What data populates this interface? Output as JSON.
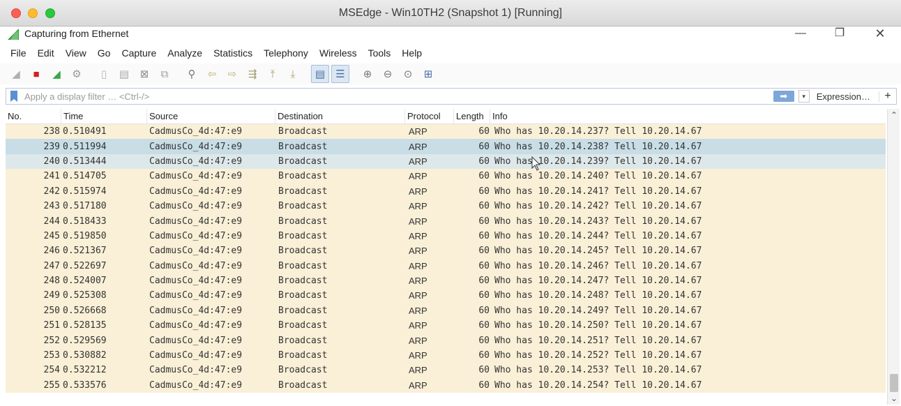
{
  "mac_window": {
    "title": "MSEdge - Win10TH2 (Snapshot 1) [Running]"
  },
  "app": {
    "title": "Capturing from Ethernet",
    "window_controls": {
      "minimize": "—",
      "restore": "❐",
      "close": "✕"
    }
  },
  "menu": [
    "File",
    "Edit",
    "View",
    "Go",
    "Capture",
    "Analyze",
    "Statistics",
    "Telephony",
    "Wireless",
    "Tools",
    "Help"
  ],
  "toolbar": {
    "icons": [
      {
        "name": "start-capture-icon",
        "glyph": "◢",
        "color": "#b0b0b0"
      },
      {
        "name": "stop-capture-icon",
        "glyph": "■",
        "color": "#d81e1e"
      },
      {
        "name": "restart-capture-icon",
        "glyph": "◢",
        "color": "#3aa64a"
      },
      {
        "name": "capture-options-icon",
        "glyph": "⚙",
        "color": "#9a9a9a"
      },
      {
        "name": "open-file-icon",
        "glyph": "▯",
        "color": "#b8b8b8"
      },
      {
        "name": "save-file-icon",
        "glyph": "▤",
        "color": "#a8a8a8"
      },
      {
        "name": "close-file-icon",
        "glyph": "⊠",
        "color": "#8c8c8c"
      },
      {
        "name": "reload-file-icon",
        "glyph": "⧉",
        "color": "#9a9a9a"
      },
      {
        "name": "find-packet-icon",
        "glyph": "⚲",
        "color": "#777777"
      },
      {
        "name": "go-back-icon",
        "glyph": "⇦",
        "color": "#c0b070"
      },
      {
        "name": "go-forward-icon",
        "glyph": "⇨",
        "color": "#c0b070"
      },
      {
        "name": "go-to-packet-icon",
        "glyph": "⇶",
        "color": "#a0a070"
      },
      {
        "name": "go-first-packet-icon",
        "glyph": "⤒",
        "color": "#b0a060"
      },
      {
        "name": "go-last-packet-icon",
        "glyph": "⤓",
        "color": "#b0a060"
      },
      {
        "name": "autoscroll-icon",
        "glyph": "▤",
        "color": "#4a6fa5",
        "pressed": true
      },
      {
        "name": "colorize-icon",
        "glyph": "☰",
        "color": "#4a6fa5",
        "pressed": true
      },
      {
        "name": "zoom-in-icon",
        "glyph": "⊕",
        "color": "#777777"
      },
      {
        "name": "zoom-out-icon",
        "glyph": "⊖",
        "color": "#777777"
      },
      {
        "name": "zoom-normal-icon",
        "glyph": "⊙",
        "color": "#777777"
      },
      {
        "name": "resize-columns-icon",
        "glyph": "⊞",
        "color": "#4a6fa5"
      }
    ]
  },
  "filter": {
    "placeholder": "Apply a display filter … <Ctrl-/>",
    "apply_glyph": "➡",
    "dropdown_glyph": "▾",
    "expression_label": "Expression…",
    "add_glyph": "+"
  },
  "packet_list": {
    "columns": [
      "No.",
      "Time",
      "Source",
      "Destination",
      "Protocol",
      "Length",
      "Info"
    ],
    "rows": [
      {
        "no": "238",
        "time": "0.510491",
        "src": "CadmusCo_4d:47:e9",
        "dst": "Broadcast",
        "proto": "ARP",
        "len": "60",
        "info": "Who has 10.20.14.237? Tell 10.20.14.67"
      },
      {
        "no": "239",
        "time": "0.511994",
        "src": "CadmusCo_4d:47:e9",
        "dst": "Broadcast",
        "proto": "ARP",
        "len": "60",
        "info": "Who has 10.20.14.238? Tell 10.20.14.67",
        "state": "selected"
      },
      {
        "no": "240",
        "time": "0.513444",
        "src": "CadmusCo_4d:47:e9",
        "dst": "Broadcast",
        "proto": "ARP",
        "len": "60",
        "info": "Who has 10.20.14.239? Tell 10.20.14.67",
        "state": "hover"
      },
      {
        "no": "241",
        "time": "0.514705",
        "src": "CadmusCo_4d:47:e9",
        "dst": "Broadcast",
        "proto": "ARP",
        "len": "60",
        "info": "Who has 10.20.14.240? Tell 10.20.14.67"
      },
      {
        "no": "242",
        "time": "0.515974",
        "src": "CadmusCo_4d:47:e9",
        "dst": "Broadcast",
        "proto": "ARP",
        "len": "60",
        "info": "Who has 10.20.14.241? Tell 10.20.14.67"
      },
      {
        "no": "243",
        "time": "0.517180",
        "src": "CadmusCo_4d:47:e9",
        "dst": "Broadcast",
        "proto": "ARP",
        "len": "60",
        "info": "Who has 10.20.14.242? Tell 10.20.14.67"
      },
      {
        "no": "244",
        "time": "0.518433",
        "src": "CadmusCo_4d:47:e9",
        "dst": "Broadcast",
        "proto": "ARP",
        "len": "60",
        "info": "Who has 10.20.14.243? Tell 10.20.14.67"
      },
      {
        "no": "245",
        "time": "0.519850",
        "src": "CadmusCo_4d:47:e9",
        "dst": "Broadcast",
        "proto": "ARP",
        "len": "60",
        "info": "Who has 10.20.14.244? Tell 10.20.14.67"
      },
      {
        "no": "246",
        "time": "0.521367",
        "src": "CadmusCo_4d:47:e9",
        "dst": "Broadcast",
        "proto": "ARP",
        "len": "60",
        "info": "Who has 10.20.14.245? Tell 10.20.14.67"
      },
      {
        "no": "247",
        "time": "0.522697",
        "src": "CadmusCo_4d:47:e9",
        "dst": "Broadcast",
        "proto": "ARP",
        "len": "60",
        "info": "Who has 10.20.14.246? Tell 10.20.14.67"
      },
      {
        "no": "248",
        "time": "0.524007",
        "src": "CadmusCo_4d:47:e9",
        "dst": "Broadcast",
        "proto": "ARP",
        "len": "60",
        "info": "Who has 10.20.14.247? Tell 10.20.14.67"
      },
      {
        "no": "249",
        "time": "0.525308",
        "src": "CadmusCo_4d:47:e9",
        "dst": "Broadcast",
        "proto": "ARP",
        "len": "60",
        "info": "Who has 10.20.14.248? Tell 10.20.14.67"
      },
      {
        "no": "250",
        "time": "0.526668",
        "src": "CadmusCo_4d:47:e9",
        "dst": "Broadcast",
        "proto": "ARP",
        "len": "60",
        "info": "Who has 10.20.14.249? Tell 10.20.14.67"
      },
      {
        "no": "251",
        "time": "0.528135",
        "src": "CadmusCo_4d:47:e9",
        "dst": "Broadcast",
        "proto": "ARP",
        "len": "60",
        "info": "Who has 10.20.14.250? Tell 10.20.14.67"
      },
      {
        "no": "252",
        "time": "0.529569",
        "src": "CadmusCo_4d:47:e9",
        "dst": "Broadcast",
        "proto": "ARP",
        "len": "60",
        "info": "Who has 10.20.14.251? Tell 10.20.14.67"
      },
      {
        "no": "253",
        "time": "0.530882",
        "src": "CadmusCo_4d:47:e9",
        "dst": "Broadcast",
        "proto": "ARP",
        "len": "60",
        "info": "Who has 10.20.14.252? Tell 10.20.14.67"
      },
      {
        "no": "254",
        "time": "0.532212",
        "src": "CadmusCo_4d:47:e9",
        "dst": "Broadcast",
        "proto": "ARP",
        "len": "60",
        "info": "Who has 10.20.14.253? Tell 10.20.14.67"
      },
      {
        "no": "255",
        "time": "0.533576",
        "src": "CadmusCo_4d:47:e9",
        "dst": "Broadcast",
        "proto": "ARP",
        "len": "60",
        "info": "Who has 10.20.14.254? Tell 10.20.14.67"
      }
    ]
  },
  "scrollbar": {
    "up_glyph": "⌃",
    "down_glyph": "⌄"
  },
  "colors": {
    "row_background": "#faf0d7",
    "row_selected": "#c8dde6",
    "row_hover": "#dde8ea",
    "stop_red": "#d81e1e",
    "shark_green": "#3aa64a"
  }
}
